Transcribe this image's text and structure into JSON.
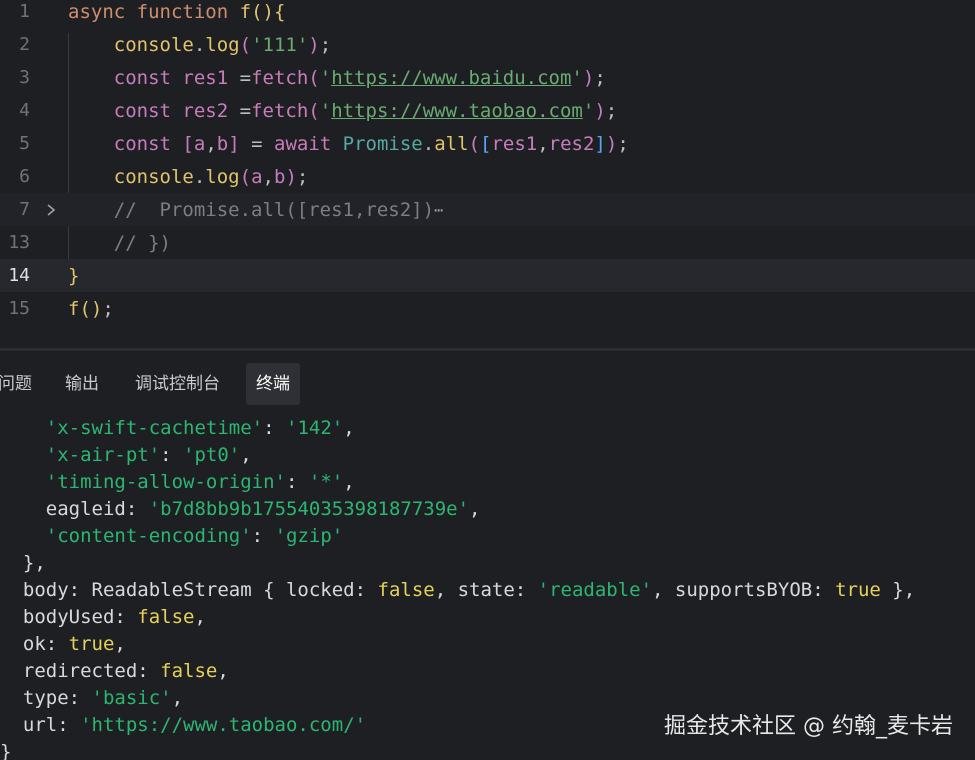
{
  "editor": {
    "lines": [
      {
        "number": "1"
      },
      {
        "number": "2"
      },
      {
        "number": "3"
      },
      {
        "number": "4"
      },
      {
        "number": "5"
      },
      {
        "number": "6"
      },
      {
        "number": "7"
      },
      {
        "number": "13"
      },
      {
        "number": "14"
      },
      {
        "number": "15"
      }
    ],
    "tokens": {
      "l1_async": "async",
      "l1_function": "function",
      "l1_name": "f",
      "l1_paren": "()",
      "l1_brace": "{",
      "l2_console": "console",
      "l2_dot": ".",
      "l2_log": "log",
      "l2_open": "(",
      "l2_str": "'111'",
      "l2_close": ")",
      "l2_semi": ";",
      "l3_const": "const",
      "l3_var": "res1",
      "l3_eq": " =",
      "l3_fetch": "fetch",
      "l3_open": "(",
      "l3_q1": "'",
      "l3_url": "https://www.baidu.com",
      "l3_q2": "'",
      "l3_close": ")",
      "l3_semi": ";",
      "l4_const": "const",
      "l4_var": "res2",
      "l4_eq": " =",
      "l4_fetch": "fetch",
      "l4_open": "(",
      "l4_q1": "'",
      "l4_url": "https://www.taobao.com",
      "l4_q2": "'",
      "l4_close": ")",
      "l4_semi": ";",
      "l5_const": "const",
      "l5_open": "[",
      "l5_a": "a",
      "l5_comma": ",",
      "l5_b": "b",
      "l5_close": "]",
      "l5_eq": " = ",
      "l5_await": "await",
      "l5_promise": "Promise",
      "l5_dot": ".",
      "l5_all": "all",
      "l5_p1": "(",
      "l5_b1": "[",
      "l5_r1": "res1",
      "l5_c": ",",
      "l5_r2": "res2",
      "l5_b2": "]",
      "l5_p2": ")",
      "l5_semi": ";",
      "l6_console": "console",
      "l6_dot": ".",
      "l6_log": "log",
      "l6_open": "(",
      "l6_a": "a",
      "l6_comma": ",",
      "l6_b": "b",
      "l6_close": ")",
      "l6_semi": ";",
      "l7_comment": "//  Promise.all([res1,res2])",
      "l7_ellipsis": "⋯",
      "l13_comment": "// })",
      "l14_brace": "}",
      "l15_f": "f",
      "l15_paren": "()",
      "l15_semi": ";"
    }
  },
  "panel": {
    "tabs": [
      {
        "label": "问题"
      },
      {
        "label": "输出"
      },
      {
        "label": "调试控制台"
      },
      {
        "label": "终端"
      }
    ],
    "active_tab": "终端"
  },
  "terminal": {
    "h1_key": "'x-swift-cachetime'",
    "h1_val": "'142'",
    "h2_key": "'x-air-pt'",
    "h2_val": "'pt0'",
    "h3_key": "'timing-allow-origin'",
    "h3_val": "'*'",
    "h4_key": "eagleid",
    "h4_val": "'b7d8bb9b17554035398187739e'",
    "h5_key": "'content-encoding'",
    "h5_val": "'gzip'",
    "close_headers": "},",
    "body_prefix": "body: ReadableStream { locked: ",
    "body_locked": "false",
    "body_mid": ", state: ",
    "body_state": "'readable'",
    "body_mid2": ", supportsBYOB: ",
    "body_byob": "true",
    "body_end": " },",
    "bodyUsed_key": "bodyUsed: ",
    "bodyUsed_val": "false",
    "ok_key": "ok: ",
    "ok_val": "true",
    "redirected_key": "redirected: ",
    "redirected_val": "false",
    "type_key": "type: ",
    "type_val": "'basic'",
    "url_key": "url: ",
    "url_val": "'https://www.taobao.com/'",
    "close_obj": "}"
  },
  "watermark": "掘金技术社区 @ 约翰_麦卡岩"
}
